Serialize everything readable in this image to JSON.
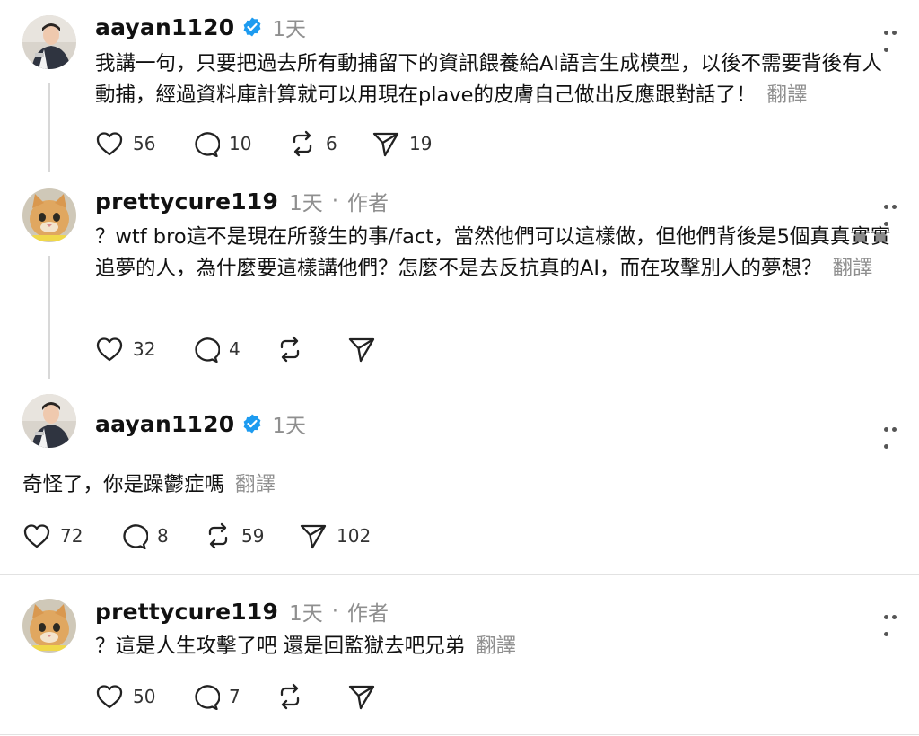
{
  "posts": [
    {
      "username": "aayan1120",
      "verified": true,
      "time": "1天",
      "text": "我講一句，只要把過去所有動捕留下的資訊餵養給AI語言生成模型，以後不需要背後有人動捕，經過資料庫計算就可以用現在plave的皮膚自己做出反應跟對話了！",
      "translate": "翻譯",
      "likes": "56",
      "comments": "10",
      "reposts": "6",
      "shares": "19"
    },
    {
      "username": "prettycure119",
      "verified": false,
      "time": "1天",
      "author_badge": "作者",
      "separator": "·",
      "text": "？wtf bro這不是現在所發生的事/fact，當然他們可以這樣做，但他們背後是5個真真實實追夢的人，為什麼要這樣講他們？怎麼不是去反抗真的AI，而在攻擊別人的夢想？",
      "translate": "翻譯",
      "likes": "32",
      "comments": "4",
      "reposts": "",
      "shares": ""
    },
    {
      "username": "aayan1120",
      "verified": true,
      "time": "1天",
      "text": "奇怪了，你是躁鬱症嗎",
      "translate": "翻譯",
      "likes": "72",
      "comments": "8",
      "reposts": "59",
      "shares": "102"
    },
    {
      "username": "prettycure119",
      "verified": false,
      "time": "1天",
      "author_badge": "作者",
      "separator": "·",
      "text": "？這是人生攻擊了吧 還是回監獄去吧兄弟",
      "translate": "翻譯",
      "likes": "50",
      "comments": "7",
      "reposts": "",
      "shares": ""
    }
  ],
  "icons": {
    "like": "heart-icon",
    "comment": "comment-icon",
    "repost": "repost-icon",
    "share": "share-icon",
    "more": "more-icon",
    "verified": "verified-badge-icon"
  },
  "colors": {
    "verified": "#1d9bf0",
    "muted": "#8f8f8f",
    "thread_line": "#d8d8d8"
  }
}
